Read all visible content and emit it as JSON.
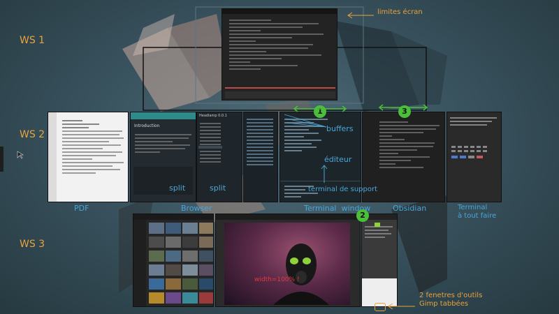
{
  "workspaces": {
    "ws1": "WS 1",
    "ws2": "WS 2",
    "ws3": "WS 3"
  },
  "annotations": {
    "screen_limits": "limites écran",
    "buffers": "buffers",
    "editor": "éditeur",
    "support_terminal": "terminal de support",
    "split_1": "split",
    "split_2": "split",
    "width": "width=100% !",
    "gimp_tools": "2 fenetres d'outils\nGimp tabbées"
  },
  "badges": {
    "one": "1",
    "two": "2",
    "three": "3"
  },
  "window_labels": {
    "pdf": "PDF",
    "browser": "Browser",
    "terminal_window": "Terminal  window",
    "obsidian": "Obsidian",
    "terminal_all": "Terminal\nà tout faire"
  },
  "browser": {
    "title": "Introduction",
    "sidebar_title": "Headlamp 0.0.1"
  },
  "colors": {
    "accent_orange": "#e8a340",
    "label_blue": "#4aa6d8",
    "badge_green": "#4bbf3a",
    "annotation_red": "#e03a3a"
  }
}
